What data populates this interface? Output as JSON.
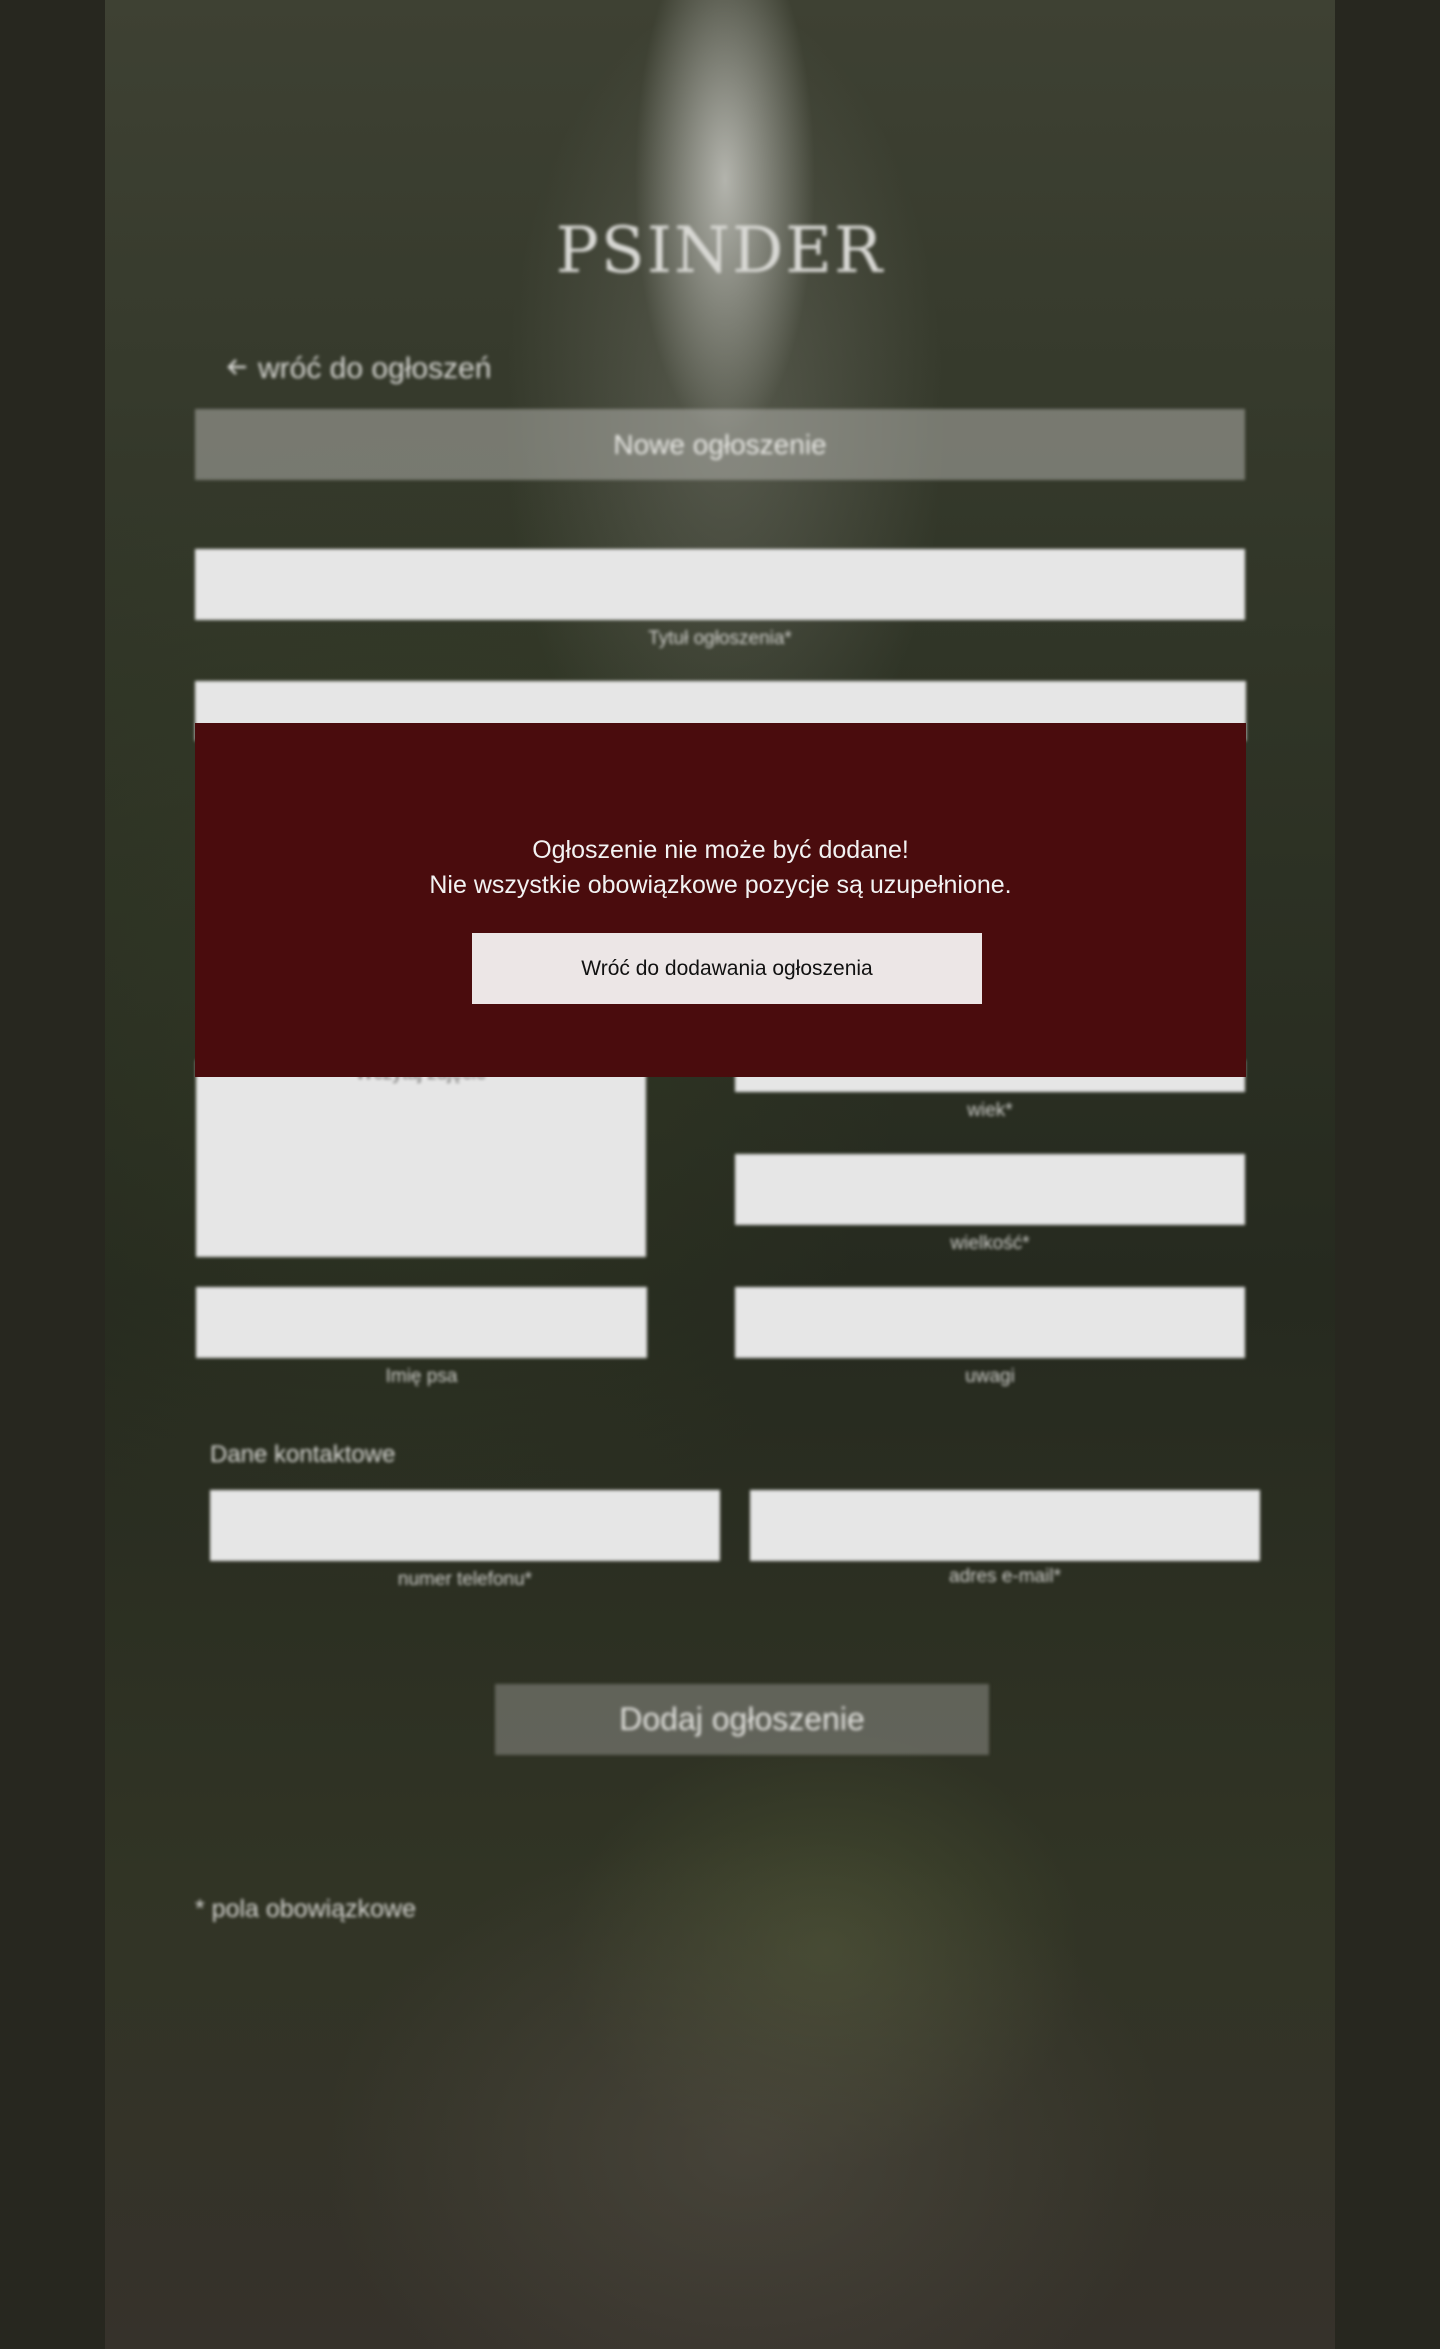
{
  "app": {
    "logo": "PSINDER"
  },
  "nav": {
    "back_label": "wróć do ogłoszeń"
  },
  "form": {
    "heading": "Nowe ogłoszenie",
    "labels": {
      "title": "Tytuł ogłoszenia*",
      "upload": "Wczytaj zdjęcie",
      "age": "wiek*",
      "size": "wielkość*",
      "dog_name": "Imię psa",
      "notes": "uwagi",
      "phone": "numer telefonu*",
      "email": "adres e-mail*"
    },
    "contact_heading": "Dane kontaktowe",
    "submit_label": "Dodaj ogłoszenie",
    "required_note": "* pola obowiązkowe"
  },
  "modal": {
    "line1": "Ogłoszenie nie może być dodane!",
    "line2": "Nie wszystkie obowiązkowe pozycje są uzupełnione.",
    "button_label": "Wróć do dodawania ogłoszenia",
    "background_color": "#4a0c0d"
  },
  "icons": {
    "back": "arrow-left-icon"
  }
}
